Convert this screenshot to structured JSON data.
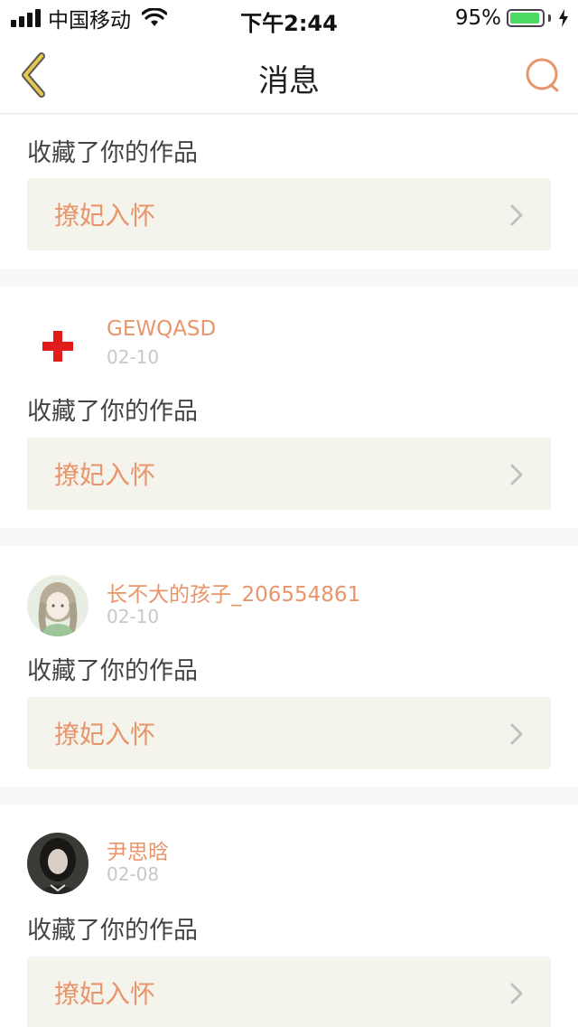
{
  "status_bar": {
    "carrier": "中国移动",
    "time": "下午2:44",
    "battery_percent": "95%",
    "battery_level": 0.95,
    "icons": [
      "signal-icon",
      "wifi-icon",
      "battery-icon",
      "charging-bolt-icon"
    ]
  },
  "nav": {
    "title": "消息",
    "back_icon": "chevron-left-icon",
    "search_icon": "search-icon",
    "accent_color": "#e8956b",
    "back_color": "#e6c84a"
  },
  "messages": [
    {
      "action": "收藏了你的作品",
      "work_title": "撩妃入怀"
    },
    {
      "username": "GEWQASD",
      "date": "02-10",
      "avatar": "red-cross-icon",
      "action": "收藏了你的作品",
      "work_title": "撩妃入怀"
    },
    {
      "username": "长不大的孩子_206554861",
      "date": "02-10",
      "avatar": "anime-girl-avatar",
      "action": "收藏了你的作品",
      "work_title": "撩妃入怀"
    },
    {
      "username": "尹思晗",
      "date": "02-08",
      "avatar": "photo-avatar",
      "action": "收藏了你的作品",
      "work_title": "撩妃入怀"
    }
  ],
  "colors": {
    "username": "#e8956b",
    "work_title": "#e8956b",
    "work_box_bg": "#f5f4ec",
    "date": "#c8c8c8",
    "separator": "#f8f8f8"
  }
}
